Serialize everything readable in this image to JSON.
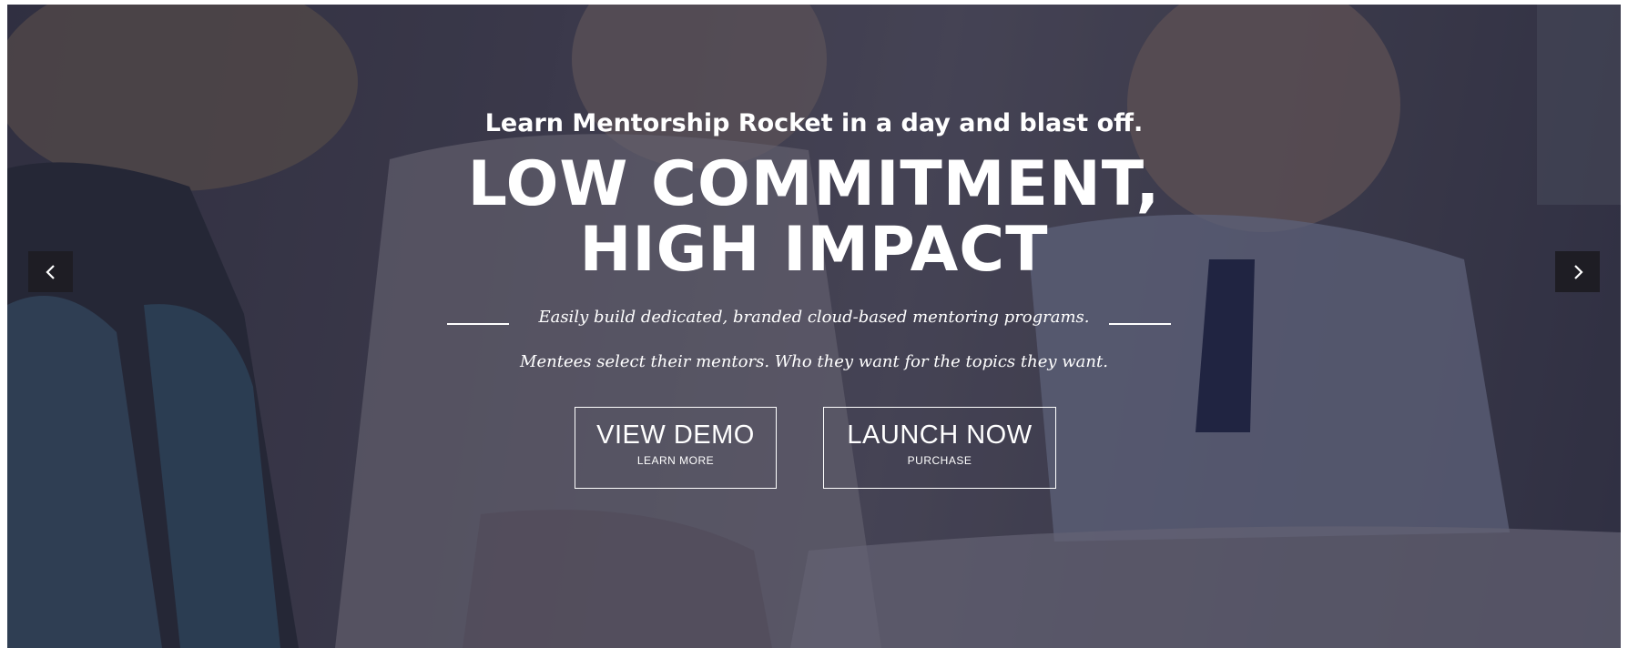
{
  "hero": {
    "subtitle": "Learn Mentorship Rocket in a day and blast off.",
    "headline_line1": "LOW COMMITMENT,",
    "headline_line2": "HIGH IMPACT",
    "description_1": "Easily build dedicated, branded cloud-based mentoring programs.",
    "description_2": "Mentees select their mentors. Who they want for the topics they want."
  },
  "buttons": {
    "demo": {
      "label": "VIEW DEMO",
      "sublabel": "LEARN MORE"
    },
    "launch": {
      "label": "LAUNCH NOW",
      "sublabel": "PURCHASE"
    }
  },
  "carousel": {
    "prev_icon": "chevron-left-icon",
    "next_icon": "chevron-right-icon"
  },
  "colors": {
    "text": "#ffffff",
    "arrow_background": "#1e1d24",
    "overlay": "#3b3a4a"
  }
}
